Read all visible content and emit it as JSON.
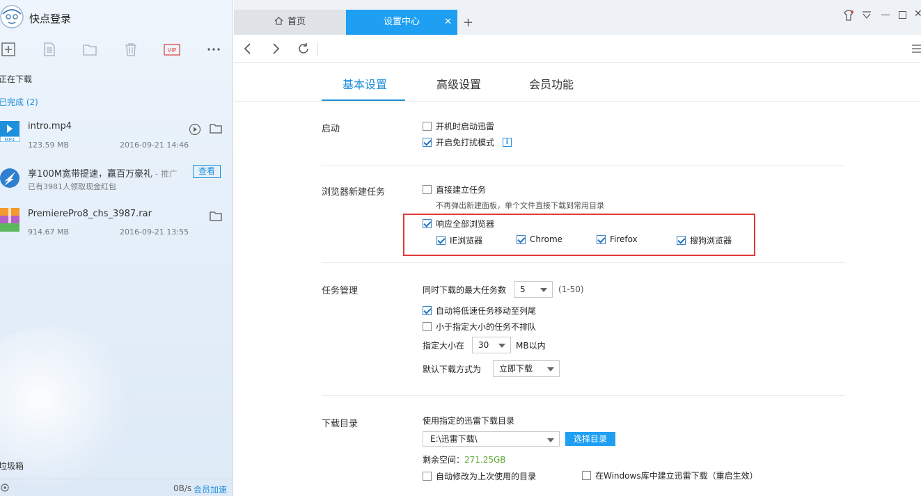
{
  "left": {
    "login_text": "快点登录",
    "sections": {
      "downloading": "正在下载",
      "completed": "已完成 (2)",
      "trash": "垃圾箱"
    },
    "downloads": [
      {
        "name": "intro.mp4",
        "size": "123.59 MB",
        "date": "2016-09-21 14:46",
        "icon_label": "MP4"
      },
      {
        "name": "享100M宽带提速，赢百万豪礼",
        "tag": " - 推广",
        "sub": "已有3981人领取现金红包",
        "action": "查看"
      },
      {
        "name": "PremierePro8_chs_3987.rar",
        "size": "914.67 MB",
        "date": "2016-09-21 13:55"
      }
    ],
    "footer": {
      "speed": "0B/s",
      "vip_speed": "会员加速"
    }
  },
  "tabs": [
    {
      "label": "首页",
      "active": false
    },
    {
      "label": "设置中心",
      "active": true
    }
  ],
  "settings_tabs": [
    "基本设置",
    "高级设置",
    "会员功能"
  ],
  "sections": {
    "startup": {
      "label": "启动",
      "items": [
        {
          "label": "开机时启动迅雷",
          "checked": false
        },
        {
          "label": "开启免打扰模式",
          "checked": true
        }
      ]
    },
    "browser": {
      "label": "浏览器新建任务",
      "direct": {
        "label": "直接建立任务",
        "checked": false
      },
      "direct_hint": "不再弹出新建面板，单个文件直接下载到常用目录",
      "respond_all": {
        "label": "响应全部浏览器",
        "checked": true
      },
      "browsers": [
        {
          "label": "IE浏览器",
          "checked": true
        },
        {
          "label": "Chrome",
          "checked": true
        },
        {
          "label": "Firefox",
          "checked": true
        },
        {
          "label": "搜狗浏览器",
          "checked": true
        }
      ]
    },
    "tasks": {
      "label": "任务管理",
      "max_label": "同时下载的最大任务数",
      "max_value": "5",
      "max_range": "(1-50)",
      "move_slow": {
        "label": "自动将低速任务移动至列尾",
        "checked": true
      },
      "no_queue": {
        "label": "小于指定大小的任务不排队",
        "checked": false
      },
      "size_label": "指定大小在",
      "size_value": "30",
      "size_unit": "MB以内",
      "mode_label": "默认下载方式为",
      "mode_value": "立即下载"
    },
    "dir": {
      "label": "下载目录",
      "use_label": "使用指定的迅雷下载目录",
      "path": "E:\\迅雷下载\\",
      "choose_btn": "选择目录",
      "free_label": "剩余空间：",
      "free_value": "271.25GB",
      "auto_last": {
        "label": "自动修改为上次使用的目录",
        "checked": false
      },
      "win_lib": {
        "label": "在Windows库中建立迅雷下载（重启生效）",
        "checked": false
      }
    }
  },
  "colors": {
    "accent": "#1e9ff2",
    "highlight_box": "#e03a3a",
    "free_space": "#58a832"
  }
}
